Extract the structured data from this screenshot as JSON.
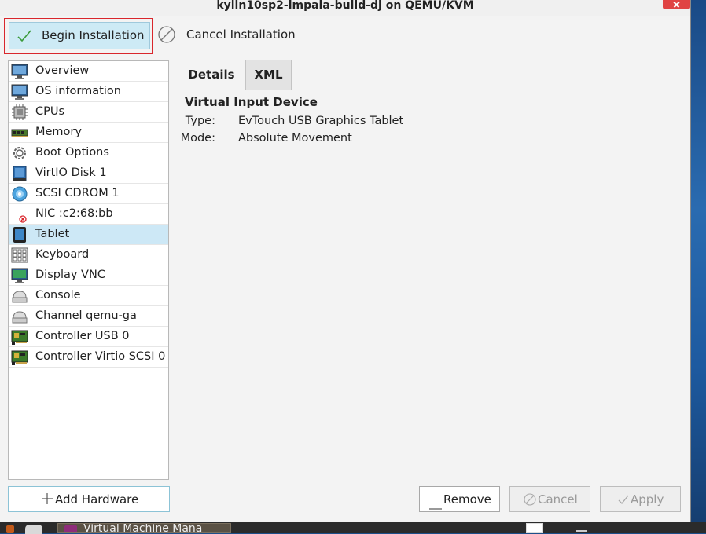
{
  "window": {
    "title": "kylin10sp2-impala-build-dj on QEMU/KVM"
  },
  "toolbar": {
    "begin_label": "Begin Installation",
    "cancel_label": "Cancel Installation"
  },
  "sidebar": {
    "items": [
      {
        "label": "Overview",
        "icon": "monitor-icon"
      },
      {
        "label": "OS information",
        "icon": "monitor-icon"
      },
      {
        "label": "CPUs",
        "icon": "cpu-icon"
      },
      {
        "label": "Memory",
        "icon": "memory-icon"
      },
      {
        "label": "Boot Options",
        "icon": "gear-icon"
      },
      {
        "label": "VirtIO Disk 1",
        "icon": "disk-icon"
      },
      {
        "label": "SCSI CDROM 1",
        "icon": "cdrom-icon"
      },
      {
        "label": "NIC :c2:68:bb",
        "icon": "network-error-icon"
      },
      {
        "label": "Tablet",
        "icon": "tablet-icon",
        "selected": true
      },
      {
        "label": "Keyboard",
        "icon": "keyboard-icon"
      },
      {
        "label": "Display VNC",
        "icon": "display-icon"
      },
      {
        "label": "Console",
        "icon": "serial-icon"
      },
      {
        "label": "Channel qemu-ga",
        "icon": "serial-icon"
      },
      {
        "label": "Controller USB 0",
        "icon": "controller-icon"
      },
      {
        "label": "Controller Virtio SCSI 0",
        "icon": "controller-icon"
      }
    ],
    "add_hardware_label": "Add Hardware"
  },
  "tabs": [
    {
      "label": "Details",
      "active": true
    },
    {
      "label": "XML",
      "active": false
    }
  ],
  "details": {
    "section_title": "Virtual Input Device",
    "type_label": "Type:",
    "type_value": "EvTouch USB Graphics Tablet",
    "mode_label": "Mode:",
    "mode_value": "Absolute Movement"
  },
  "buttons": {
    "remove": "Remove",
    "cancel": "Cancel",
    "apply": "Apply"
  },
  "taskbar": {
    "task_label": "Virtual Machine Mana"
  },
  "colors": {
    "selected_row": "#cde8f6",
    "begin_button": "#cdeaf5",
    "highlight_border": "#d9262c"
  }
}
